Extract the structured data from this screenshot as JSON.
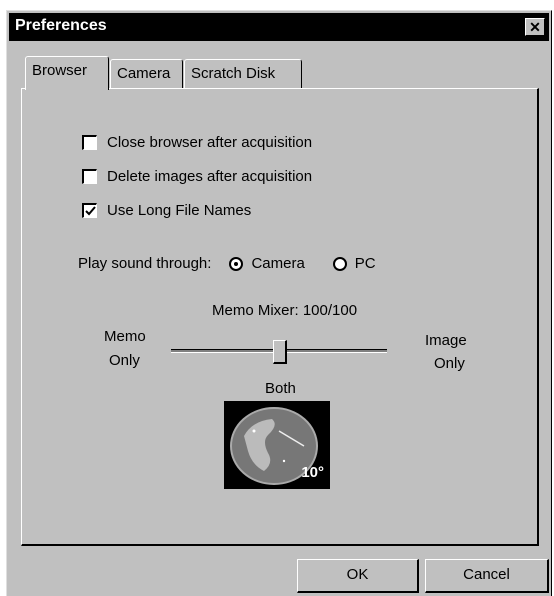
{
  "window": {
    "title": "Preferences",
    "close_icon": "close-icon"
  },
  "tabs": [
    {
      "label": "Browser",
      "active": true
    },
    {
      "label": "Camera",
      "active": false
    },
    {
      "label": "Scratch Disk",
      "active": false
    }
  ],
  "options": [
    {
      "label": "Close browser after acquisition",
      "checked": false
    },
    {
      "label": "Delete images after acquisition",
      "checked": false
    },
    {
      "label": "Use Long File Names",
      "checked": true
    }
  ],
  "sound": {
    "label": "Play sound through:",
    "options": [
      {
        "label": "Camera",
        "selected": true
      },
      {
        "label": "PC",
        "selected": false
      }
    ]
  },
  "mixer": {
    "title": "Memo Mixer:  100/100",
    "left_label_1": "Memo",
    "left_label_2": "Only",
    "right_label_1": "Image",
    "right_label_2": "Only",
    "center_label": "Both",
    "preview_badge": "10°"
  },
  "buttons": {
    "ok": "OK",
    "cancel": "Cancel"
  }
}
